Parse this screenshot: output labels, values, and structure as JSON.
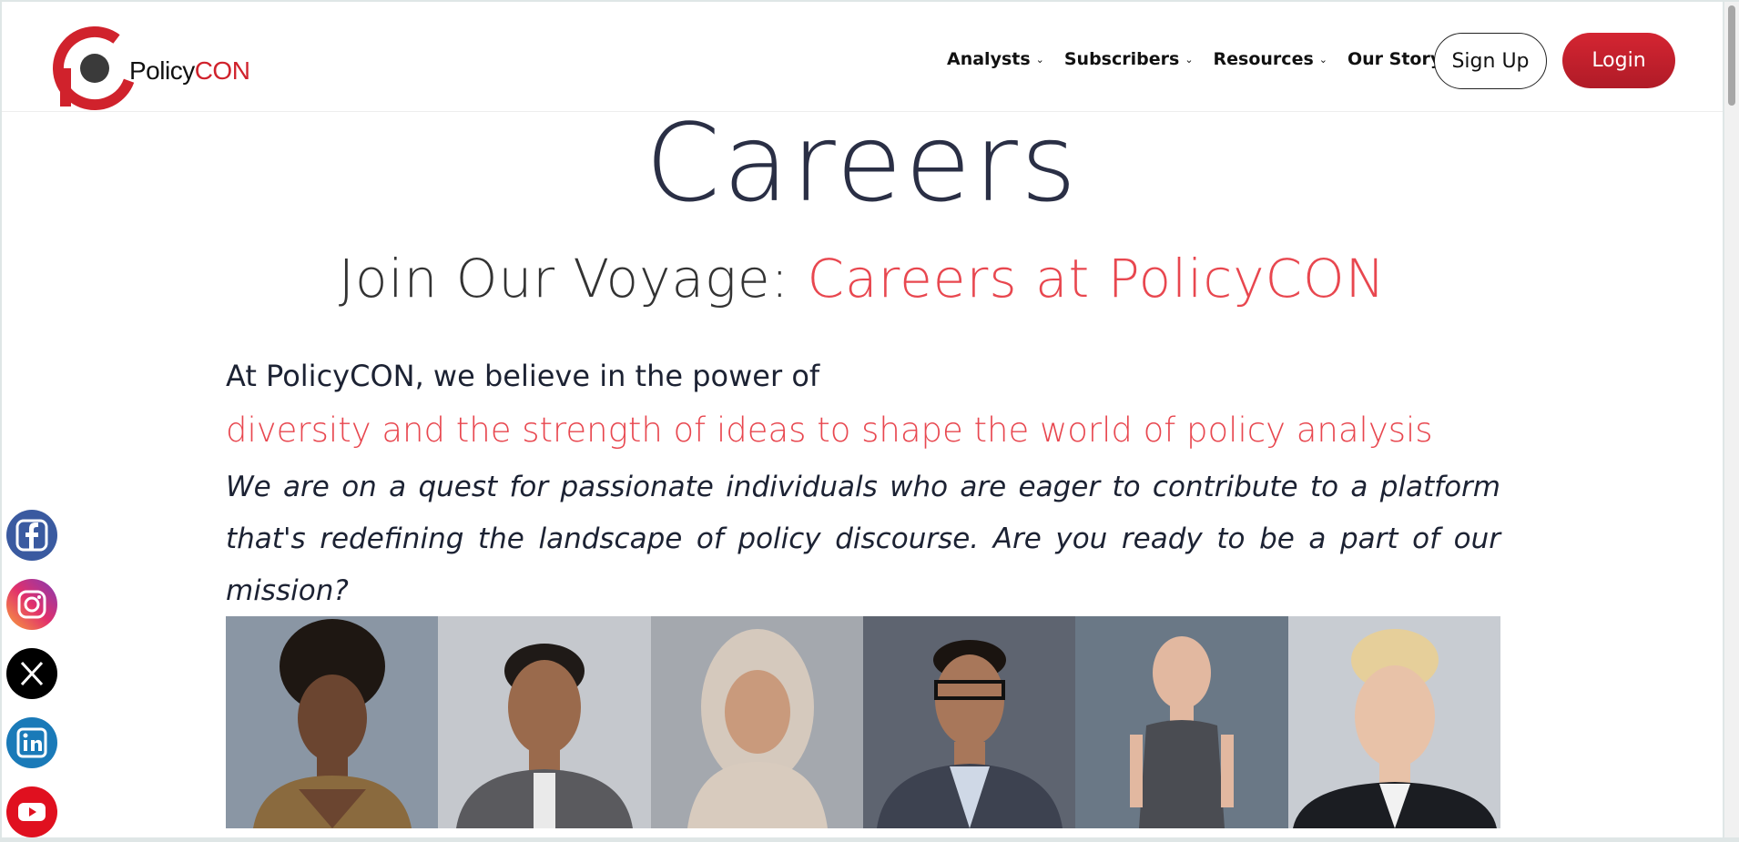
{
  "brand": {
    "name_part1": "Policy",
    "name_part2": "CON",
    "accent": "#d0222c"
  },
  "nav": {
    "items": [
      {
        "label": "Analysts"
      },
      {
        "label": "Subscribers"
      },
      {
        "label": "Resources"
      },
      {
        "label": "Our Story"
      }
    ],
    "signup_label": "Sign Up",
    "login_label": "Login"
  },
  "main": {
    "title": "Careers",
    "subtitle_part1": "Join Our Voyage: ",
    "subtitle_part2": "Careers at PolicyCON",
    "intro": "At PolicyCON, we believe in the power of",
    "highlight": "diversity and the strength of ideas to shape the world of policy analysis",
    "mission": "We are on a quest for passionate individuals who are eager to contribute to a platform that's redefining the landscape of policy discourse. Are you ready to be a part of our mission?"
  },
  "social": {
    "icons": [
      "facebook-icon",
      "instagram-icon",
      "x-icon",
      "linkedin-icon",
      "youtube-icon"
    ]
  },
  "colors": {
    "accent": "#e8474f",
    "text_dark": "#1c2233",
    "login_bg": "#c8202d"
  }
}
